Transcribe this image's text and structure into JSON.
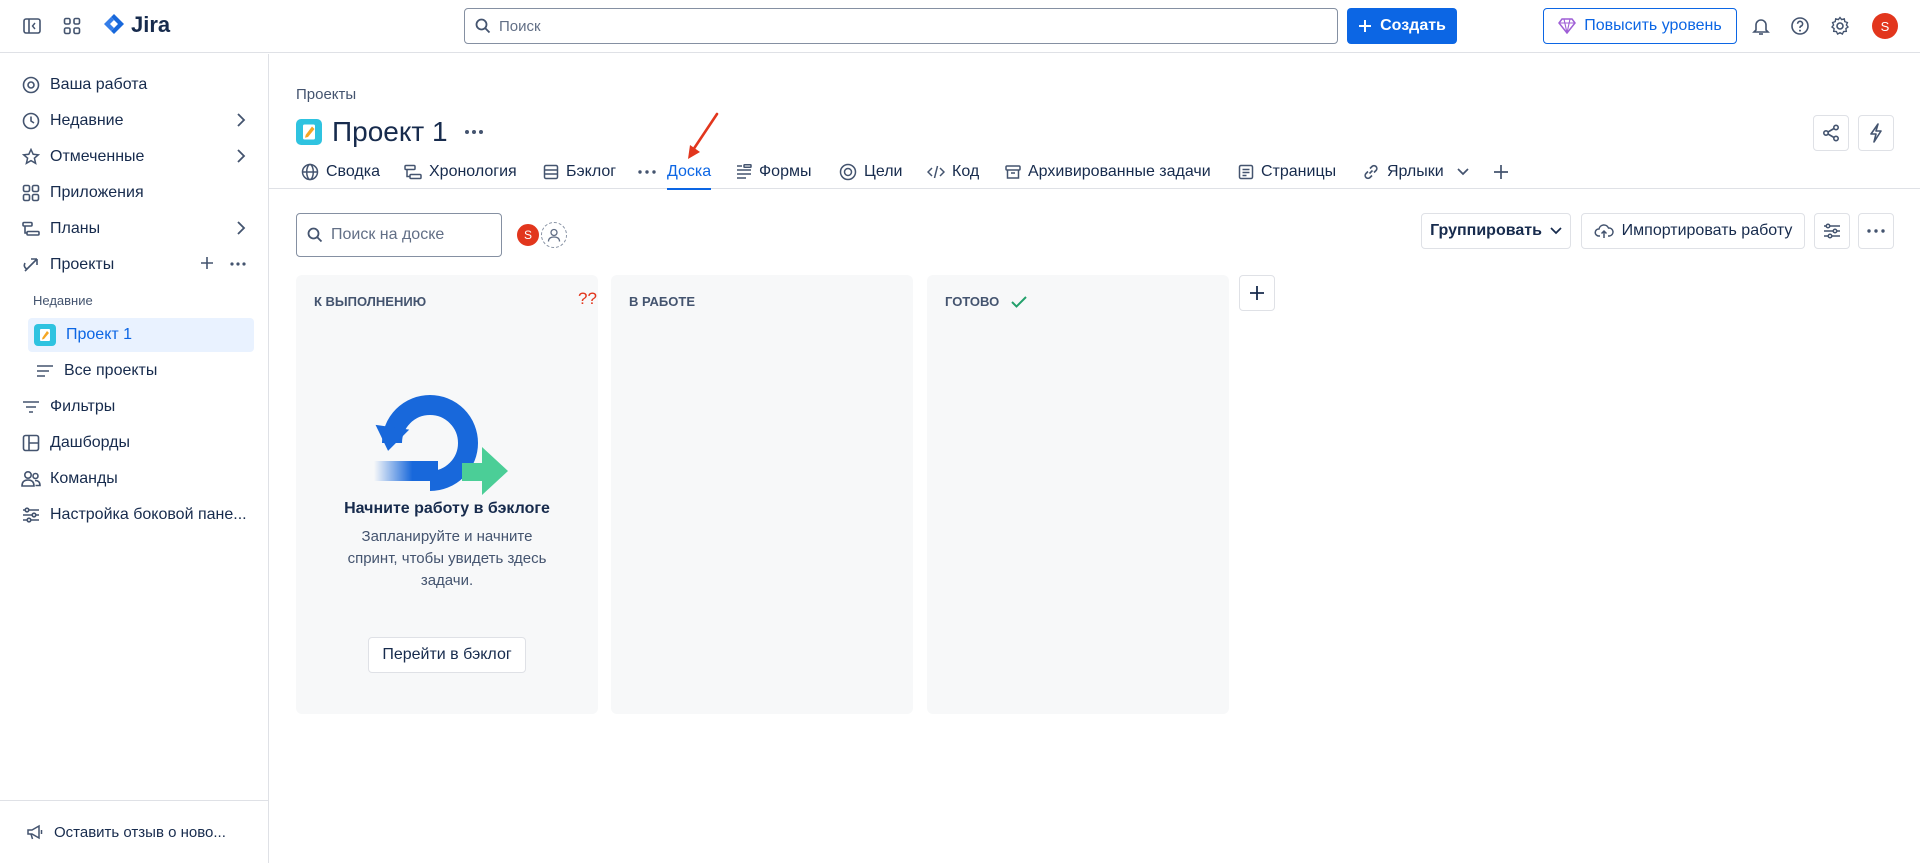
{
  "app": {
    "name": "Jira",
    "search_placeholder": "Поиск",
    "create_label": "Создать",
    "upgrade_label": "Повысить уровень",
    "avatar_initial": "S"
  },
  "sidebar": {
    "items": [
      {
        "label": "Ваша работа",
        "icon": "your-work-icon"
      },
      {
        "label": "Недавние",
        "icon": "clock-icon"
      },
      {
        "label": "Отмеченные",
        "icon": "star-icon"
      },
      {
        "label": "Приложения",
        "icon": "apps-icon"
      },
      {
        "label": "Планы",
        "icon": "plans-icon"
      },
      {
        "label": "Проекты",
        "icon": "projects-icon"
      }
    ],
    "recent_section": "Недавние",
    "project_item": "Проект 1",
    "all_projects": "Все проекты",
    "bottom_items": [
      {
        "label": "Фильтры",
        "icon": "filter-icon"
      },
      {
        "label": "Дашборды",
        "icon": "dashboard-icon"
      },
      {
        "label": "Команды",
        "icon": "teams-icon"
      },
      {
        "label": "Настройка боковой пане...",
        "icon": "customize-icon"
      }
    ],
    "feedback": "Оставить отзыв о ново..."
  },
  "header": {
    "breadcrumb": "Проекты",
    "title": "Проект 1"
  },
  "tabs": [
    {
      "label": "Сводка",
      "icon": "globe-icon"
    },
    {
      "label": "Хронология",
      "icon": "timeline-icon"
    },
    {
      "label": "Бэклог",
      "icon": "backlog-icon"
    },
    {
      "label": "Доска",
      "icon": "more-icon",
      "active": true
    },
    {
      "label": "Формы",
      "icon": "forms-icon"
    },
    {
      "label": "Цели",
      "icon": "goals-icon"
    },
    {
      "label": "Код",
      "icon": "code-icon"
    },
    {
      "label": "Архивированные задачи",
      "icon": "archive-icon"
    },
    {
      "label": "Страницы",
      "icon": "pages-icon"
    },
    {
      "label": "Ярлыки",
      "icon": "link-icon"
    }
  ],
  "board": {
    "search_placeholder": "Поиск на доске",
    "avatar_initial": "S",
    "group_label": "Группировать",
    "import_label": "Импортировать работу",
    "columns": [
      {
        "title": "К ВЫПОЛНЕНИЮ",
        "marker": "??"
      },
      {
        "title": "В РАБОТЕ"
      },
      {
        "title": "ГОТОВО"
      }
    ],
    "empty": {
      "title": "Начните работу в бэклоге",
      "description": "Запланируйте и начните спринт, чтобы увидеть здесь задачи.",
      "button": "Перейти в бэклог"
    }
  },
  "colors": {
    "accent": "#0c66e4",
    "avatar": "#e2361d",
    "done_check": "#22a06b",
    "annotation_arrow": "#e2361d"
  }
}
